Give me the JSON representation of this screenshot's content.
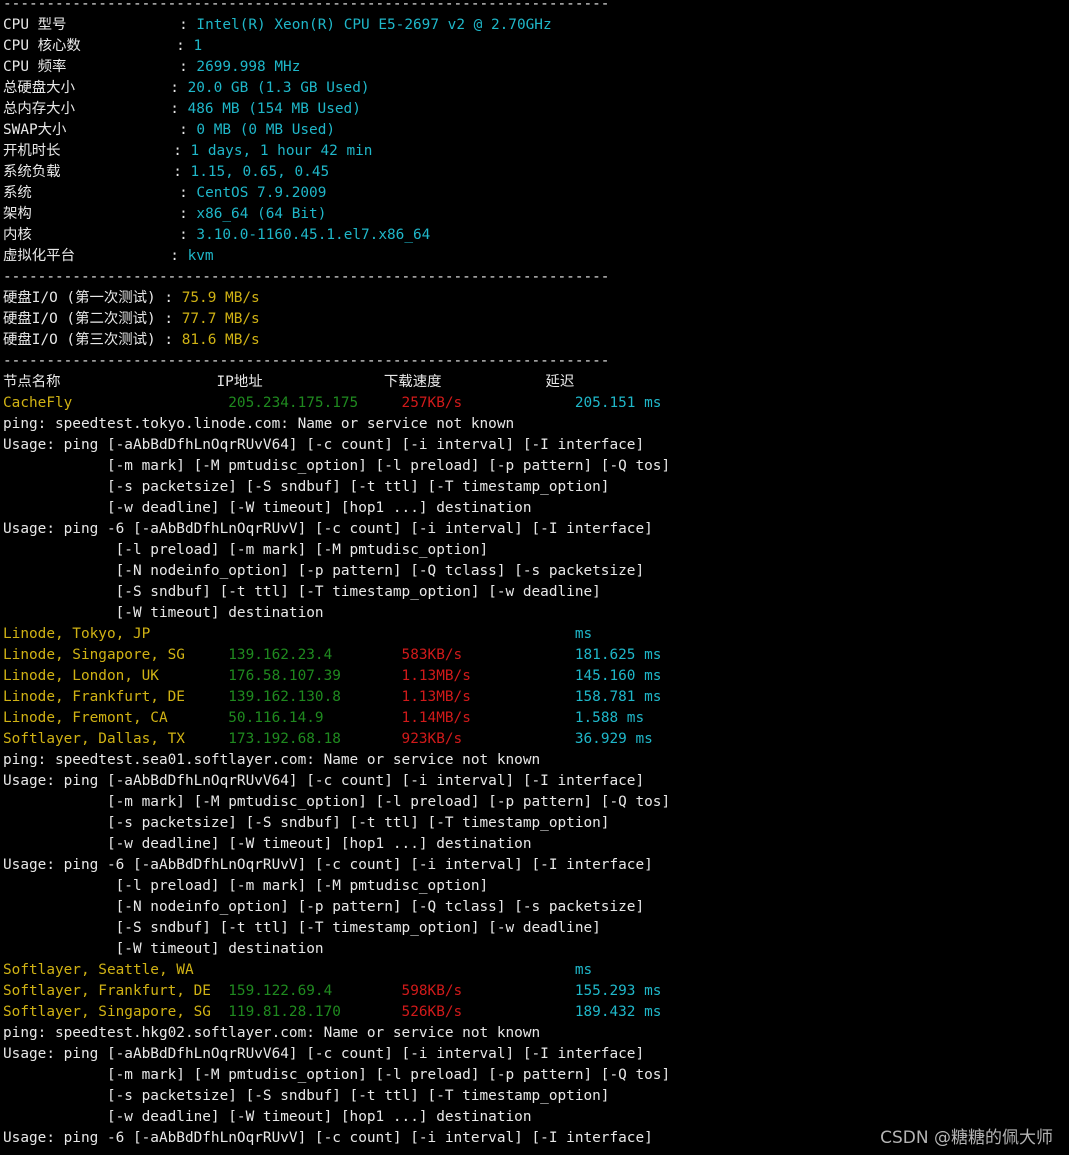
{
  "colors": {
    "background": "#000000",
    "label": "#e8e8e8",
    "value": "#1fb7c9",
    "io": "#d0b214",
    "node": "#d0b214",
    "ip": "#1f8a1f",
    "speed": "#d11a1a",
    "latency": "#1fb7c9",
    "watermark": "#b4b4b4"
  },
  "watermark": "CSDN @糖糖的佩大师",
  "lines": [
    {
      "kind": "divider",
      "segments": [
        {
          "t": "----------------------------------------------------------------------",
          "c": "white"
        }
      ]
    },
    {
      "kind": "info",
      "segments": [
        {
          "t": "CPU 型号             : ",
          "c": "white"
        },
        {
          "t": "Intel(R) Xeon(R) CPU E5-2697 v2 @ 2.70GHz",
          "c": "cyan"
        }
      ]
    },
    {
      "kind": "info",
      "segments": [
        {
          "t": "CPU 核心数           : ",
          "c": "white"
        },
        {
          "t": "1",
          "c": "cyan"
        }
      ]
    },
    {
      "kind": "info",
      "segments": [
        {
          "t": "CPU 频率             : ",
          "c": "white"
        },
        {
          "t": "2699.998 MHz",
          "c": "cyan"
        }
      ]
    },
    {
      "kind": "info",
      "segments": [
        {
          "t": "总硬盘大小           : ",
          "c": "white"
        },
        {
          "t": "20.0 GB (1.3 GB Used)",
          "c": "cyan"
        }
      ]
    },
    {
      "kind": "info",
      "segments": [
        {
          "t": "总内存大小           : ",
          "c": "white"
        },
        {
          "t": "486 MB (154 MB Used)",
          "c": "cyan"
        }
      ]
    },
    {
      "kind": "info",
      "segments": [
        {
          "t": "SWAP大小             : ",
          "c": "white"
        },
        {
          "t": "0 MB (0 MB Used)",
          "c": "cyan"
        }
      ]
    },
    {
      "kind": "info",
      "segments": [
        {
          "t": "开机时长             : ",
          "c": "white"
        },
        {
          "t": "1 days, 1 hour 42 min",
          "c": "cyan"
        }
      ]
    },
    {
      "kind": "info",
      "segments": [
        {
          "t": "系统负载             : ",
          "c": "white"
        },
        {
          "t": "1.15, 0.65, 0.45",
          "c": "cyan"
        }
      ]
    },
    {
      "kind": "info",
      "segments": [
        {
          "t": "系统                 : ",
          "c": "white"
        },
        {
          "t": "CentOS 7.9.2009",
          "c": "cyan"
        }
      ]
    },
    {
      "kind": "info",
      "segments": [
        {
          "t": "架构                 : ",
          "c": "white"
        },
        {
          "t": "x86_64 (64 Bit)",
          "c": "cyan"
        }
      ]
    },
    {
      "kind": "info",
      "segments": [
        {
          "t": "内核                 : ",
          "c": "white"
        },
        {
          "t": "3.10.0-1160.45.1.el7.x86_64",
          "c": "cyan"
        }
      ]
    },
    {
      "kind": "info",
      "segments": [
        {
          "t": "虚拟化平台           : ",
          "c": "white"
        },
        {
          "t": "kvm",
          "c": "cyan"
        }
      ]
    },
    {
      "kind": "divider",
      "segments": [
        {
          "t": "----------------------------------------------------------------------",
          "c": "white"
        }
      ]
    },
    {
      "kind": "io",
      "segments": [
        {
          "t": "硬盘I/O (第一次测试) : ",
          "c": "white"
        },
        {
          "t": "75.9 MB/s",
          "c": "yellow"
        }
      ]
    },
    {
      "kind": "io",
      "segments": [
        {
          "t": "硬盘I/O (第二次测试) : ",
          "c": "white"
        },
        {
          "t": "77.7 MB/s",
          "c": "yellow"
        }
      ]
    },
    {
      "kind": "io",
      "segments": [
        {
          "t": "硬盘I/O (第三次测试) : ",
          "c": "white"
        },
        {
          "t": "81.6 MB/s",
          "c": "yellow"
        }
      ]
    },
    {
      "kind": "divider",
      "segments": [
        {
          "t": "----------------------------------------------------------------------",
          "c": "white"
        }
      ]
    },
    {
      "kind": "table-header",
      "segments": [
        {
          "t": "节点名称                  IP地址              下载速度            延迟",
          "c": "white"
        }
      ]
    },
    {
      "kind": "node",
      "segments": [
        {
          "t": "CacheFly                  ",
          "c": "yellow"
        },
        {
          "t": "205.234.175.175     ",
          "c": "green"
        },
        {
          "t": "257KB/s             ",
          "c": "red"
        },
        {
          "t": "205.151 ms",
          "c": "cyan"
        }
      ]
    },
    {
      "kind": "output",
      "segments": [
        {
          "t": "ping: speedtest.tokyo.linode.com: Name or service not known",
          "c": "white"
        }
      ]
    },
    {
      "kind": "output",
      "segments": [
        {
          "t": "Usage: ping [-aAbBdDfhLnOqrRUvV64] [-c count] [-i interval] [-I interface]",
          "c": "white"
        }
      ]
    },
    {
      "kind": "output",
      "segments": [
        {
          "t": "            [-m mark] [-M pmtudisc_option] [-l preload] [-p pattern] [-Q tos]",
          "c": "white"
        }
      ]
    },
    {
      "kind": "output",
      "segments": [
        {
          "t": "            [-s packetsize] [-S sndbuf] [-t ttl] [-T timestamp_option]",
          "c": "white"
        }
      ]
    },
    {
      "kind": "output",
      "segments": [
        {
          "t": "            [-w deadline] [-W timeout] [hop1 ...] destination",
          "c": "white"
        }
      ]
    },
    {
      "kind": "output",
      "segments": [
        {
          "t": "Usage: ping -6 [-aAbBdDfhLnOqrRUvV] [-c count] [-i interval] [-I interface]",
          "c": "white"
        }
      ]
    },
    {
      "kind": "output",
      "segments": [
        {
          "t": "             [-l preload] [-m mark] [-M pmtudisc_option]",
          "c": "white"
        }
      ]
    },
    {
      "kind": "output",
      "segments": [
        {
          "t": "             [-N nodeinfo_option] [-p pattern] [-Q tclass] [-s packetsize]",
          "c": "white"
        }
      ]
    },
    {
      "kind": "output",
      "segments": [
        {
          "t": "             [-S sndbuf] [-t ttl] [-T timestamp_option] [-w deadline]",
          "c": "white"
        }
      ]
    },
    {
      "kind": "output",
      "segments": [
        {
          "t": "             [-W timeout] destination",
          "c": "white"
        }
      ]
    },
    {
      "kind": "node",
      "segments": [
        {
          "t": "Linode, Tokyo, JP                                                 ",
          "c": "yellow"
        },
        {
          "t": "ms",
          "c": "cyan"
        }
      ]
    },
    {
      "kind": "node",
      "segments": [
        {
          "t": "Linode, Singapore, SG     ",
          "c": "yellow"
        },
        {
          "t": "139.162.23.4        ",
          "c": "green"
        },
        {
          "t": "583KB/s             ",
          "c": "red"
        },
        {
          "t": "181.625 ms",
          "c": "cyan"
        }
      ]
    },
    {
      "kind": "node",
      "segments": [
        {
          "t": "Linode, London, UK        ",
          "c": "yellow"
        },
        {
          "t": "176.58.107.39       ",
          "c": "green"
        },
        {
          "t": "1.13MB/s            ",
          "c": "red"
        },
        {
          "t": "145.160 ms",
          "c": "cyan"
        }
      ]
    },
    {
      "kind": "node",
      "segments": [
        {
          "t": "Linode, Frankfurt, DE     ",
          "c": "yellow"
        },
        {
          "t": "139.162.130.8       ",
          "c": "green"
        },
        {
          "t": "1.13MB/s            ",
          "c": "red"
        },
        {
          "t": "158.781 ms",
          "c": "cyan"
        }
      ]
    },
    {
      "kind": "node",
      "segments": [
        {
          "t": "Linode, Fremont, CA       ",
          "c": "yellow"
        },
        {
          "t": "50.116.14.9         ",
          "c": "green"
        },
        {
          "t": "1.14MB/s            ",
          "c": "red"
        },
        {
          "t": "1.588 ms",
          "c": "cyan"
        }
      ]
    },
    {
      "kind": "node",
      "segments": [
        {
          "t": "Softlayer, Dallas, TX     ",
          "c": "yellow"
        },
        {
          "t": "173.192.68.18       ",
          "c": "green"
        },
        {
          "t": "923KB/s             ",
          "c": "red"
        },
        {
          "t": "36.929 ms",
          "c": "cyan"
        }
      ]
    },
    {
      "kind": "output",
      "segments": [
        {
          "t": "ping: speedtest.sea01.softlayer.com: Name or service not known",
          "c": "white"
        }
      ]
    },
    {
      "kind": "output",
      "segments": [
        {
          "t": "Usage: ping [-aAbBdDfhLnOqrRUvV64] [-c count] [-i interval] [-I interface]",
          "c": "white"
        }
      ]
    },
    {
      "kind": "output",
      "segments": [
        {
          "t": "            [-m mark] [-M pmtudisc_option] [-l preload] [-p pattern] [-Q tos]",
          "c": "white"
        }
      ]
    },
    {
      "kind": "output",
      "segments": [
        {
          "t": "            [-s packetsize] [-S sndbuf] [-t ttl] [-T timestamp_option]",
          "c": "white"
        }
      ]
    },
    {
      "kind": "output",
      "segments": [
        {
          "t": "            [-w deadline] [-W timeout] [hop1 ...] destination",
          "c": "white"
        }
      ]
    },
    {
      "kind": "output",
      "segments": [
        {
          "t": "Usage: ping -6 [-aAbBdDfhLnOqrRUvV] [-c count] [-i interval] [-I interface]",
          "c": "white"
        }
      ]
    },
    {
      "kind": "output",
      "segments": [
        {
          "t": "             [-l preload] [-m mark] [-M pmtudisc_option]",
          "c": "white"
        }
      ]
    },
    {
      "kind": "output",
      "segments": [
        {
          "t": "             [-N nodeinfo_option] [-p pattern] [-Q tclass] [-s packetsize]",
          "c": "white"
        }
      ]
    },
    {
      "kind": "output",
      "segments": [
        {
          "t": "             [-S sndbuf] [-t ttl] [-T timestamp_option] [-w deadline]",
          "c": "white"
        }
      ]
    },
    {
      "kind": "output",
      "segments": [
        {
          "t": "             [-W timeout] destination",
          "c": "white"
        }
      ]
    },
    {
      "kind": "node",
      "segments": [
        {
          "t": "Softlayer, Seattle, WA                                            ",
          "c": "yellow"
        },
        {
          "t": "ms",
          "c": "cyan"
        }
      ]
    },
    {
      "kind": "node",
      "segments": [
        {
          "t": "Softlayer, Frankfurt, DE  ",
          "c": "yellow"
        },
        {
          "t": "159.122.69.4        ",
          "c": "green"
        },
        {
          "t": "598KB/s             ",
          "c": "red"
        },
        {
          "t": "155.293 ms",
          "c": "cyan"
        }
      ]
    },
    {
      "kind": "node",
      "segments": [
        {
          "t": "Softlayer, Singapore, SG  ",
          "c": "yellow"
        },
        {
          "t": "119.81.28.170       ",
          "c": "green"
        },
        {
          "t": "526KB/s             ",
          "c": "red"
        },
        {
          "t": "189.432 ms",
          "c": "cyan"
        }
      ]
    },
    {
      "kind": "output",
      "segments": [
        {
          "t": "ping: speedtest.hkg02.softlayer.com: Name or service not known",
          "c": "white"
        }
      ]
    },
    {
      "kind": "output",
      "segments": [
        {
          "t": "Usage: ping [-aAbBdDfhLnOqrRUvV64] [-c count] [-i interval] [-I interface]",
          "c": "white"
        }
      ]
    },
    {
      "kind": "output",
      "segments": [
        {
          "t": "            [-m mark] [-M pmtudisc_option] [-l preload] [-p pattern] [-Q tos]",
          "c": "white"
        }
      ]
    },
    {
      "kind": "output",
      "segments": [
        {
          "t": "            [-s packetsize] [-S sndbuf] [-t ttl] [-T timestamp_option]",
          "c": "white"
        }
      ]
    },
    {
      "kind": "output",
      "segments": [
        {
          "t": "            [-w deadline] [-W timeout] [hop1 ...] destination",
          "c": "white"
        }
      ]
    },
    {
      "kind": "output",
      "segments": [
        {
          "t": "Usage: ping -6 [-aAbBdDfhLnOqrRUvV] [-c count] [-i interval] [-I interface]",
          "c": "white"
        }
      ]
    }
  ]
}
